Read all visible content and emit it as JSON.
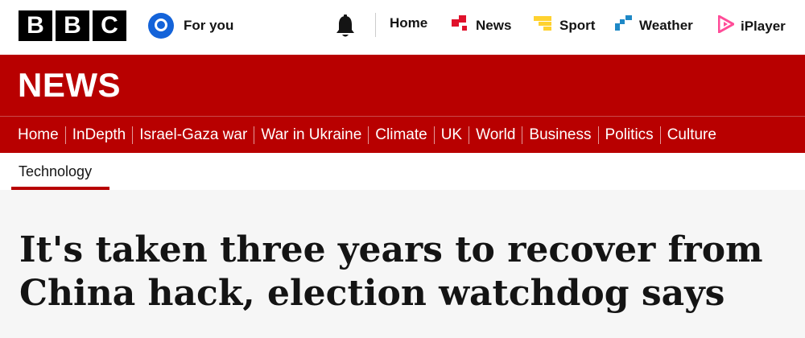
{
  "brand": {
    "letters": [
      "B",
      "B",
      "C"
    ]
  },
  "header": {
    "for_you_label": "For you",
    "nav": [
      {
        "label": "Home",
        "icon": "none"
      },
      {
        "label": "News",
        "icon": "news-icon"
      },
      {
        "label": "Sport",
        "icon": "sport-icon"
      },
      {
        "label": "Weather",
        "icon": "weather-icon"
      },
      {
        "label": "iPlayer",
        "icon": "iplayer-icon"
      }
    ]
  },
  "banner": {
    "title": "NEWS"
  },
  "section_nav": {
    "items": [
      "Home",
      "InDepth",
      "Israel-Gaza war",
      "War in Ukraine",
      "Climate",
      "UK",
      "World",
      "Business",
      "Politics",
      "Culture"
    ]
  },
  "sub_nav": {
    "active": "Technology"
  },
  "article": {
    "headline": "It's taken three years to recover from China hack, election watchdog says"
  },
  "colors": {
    "brand_red": "#b80000",
    "news_icon": "#e0112b",
    "sport_icon": "#ffd230",
    "weather_icon": "#1e88c6",
    "iplayer_icon": "#ff4c98",
    "for_you_icon": "#1463d9"
  }
}
